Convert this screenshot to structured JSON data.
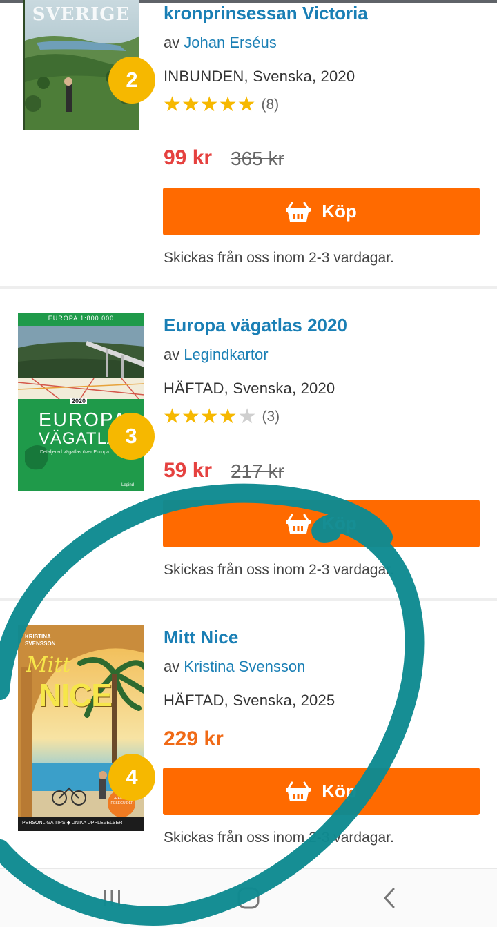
{
  "products": [
    {
      "rank": "2",
      "title": "kronprinsessan Victoria",
      "by": "av",
      "author": "Johan Erséus",
      "meta": "INBUNDEN, Svenska, 2020",
      "rating": 5,
      "stars": "★★★★★",
      "stars_off": "",
      "rating_count": "(8)",
      "price": "99 kr",
      "old_price": "365 kr",
      "buy_label": "Köp",
      "shipping": "Skickas från oss inom 2-3 vardagar.",
      "cover": {
        "text": "SVERIGE"
      }
    },
    {
      "rank": "3",
      "title": "Europa vägatlas 2020",
      "by": "av",
      "author": "Legindkartor",
      "meta": "HÄFTAD, Svenska, 2020",
      "rating": 4,
      "stars": "★★★★",
      "stars_off": "★",
      "rating_count": "(3)",
      "price": "59 kr",
      "old_price": "217 kr",
      "buy_label": "Köp",
      "shipping": "Skickas från oss inom 2-3 vardagar.",
      "cover": {
        "banner": "EUROPA 1:800 000",
        "year": "2020",
        "line1": "EUROPA",
        "line2": "VÄGATLAS",
        "subtitle": "Detaljerad vägatlas över Europa",
        "publisher": "Legind"
      }
    },
    {
      "rank": "4",
      "title": "Mitt Nice",
      "by": "av",
      "author": "Kristina Svensson",
      "meta": "HÄFTAD, Svenska, 2025",
      "price": "229 kr",
      "buy_label": "Köp",
      "shipping": "Skickas från oss inom 2-3 vardagar.",
      "cover": {
        "author_line1": "KRISTINA",
        "author_line2": "SVENSSON",
        "script": "Mitt",
        "big": "NICE",
        "footer": "PERSONLIGA TIPS  ◆  UNIKA UPPLEVELSER",
        "sticker": "GRANSKAD RESEGUIDER"
      }
    }
  ],
  "navbar": {
    "recent_icon": "recent-apps-icon",
    "home_icon": "home-icon",
    "back_icon": "back-icon"
  },
  "colors": {
    "accent": "#ff6a00",
    "link": "#1a7fb5",
    "badge": "#f6b800",
    "sale": "#e5413f",
    "price_regular": "#f06a16",
    "annotation": "#0e8a91"
  }
}
